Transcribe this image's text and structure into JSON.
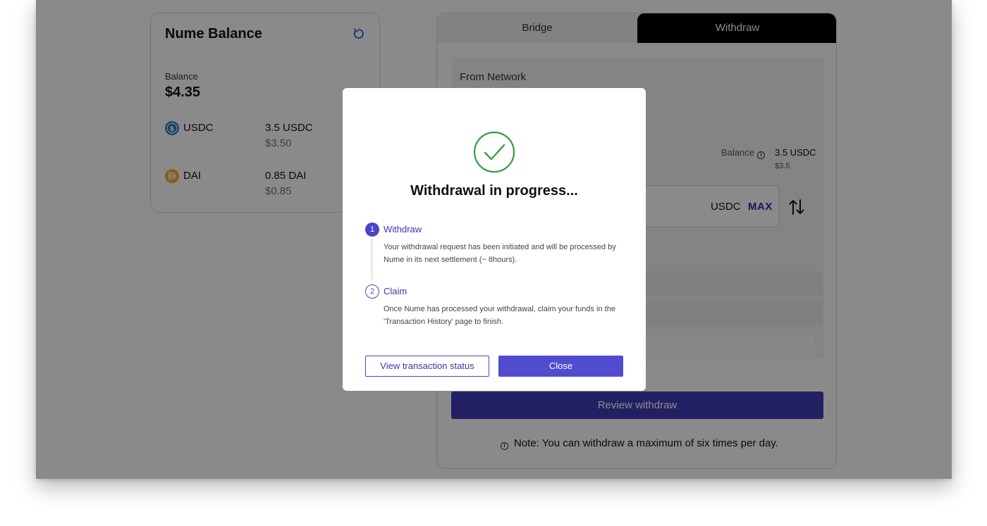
{
  "balance_card": {
    "title": "Nume Balance",
    "balance_label": "Balance",
    "balance_value": "$4.35",
    "tokens": [
      {
        "name": "USDC",
        "amount": "3.5 USDC",
        "usd": "$3.50",
        "icon": "usdc-icon",
        "color": "#2775ca"
      },
      {
        "name": "DAI",
        "amount": "0.85 DAI",
        "usd": "$0.85",
        "icon": "dai-icon",
        "color": "#f5ac37"
      }
    ]
  },
  "panel": {
    "tabs": [
      "Bridge",
      "Withdraw"
    ],
    "active_tab": "Withdraw",
    "from_network_label": "From Network",
    "balance_label": "Balance",
    "balance_token": "3.5 USDC",
    "balance_usd": "$3.5",
    "amount_token": "USDC",
    "max_label": "MAX",
    "review_button": "Review withdraw",
    "note": "Note: You can withdraw a maximum of six times per day."
  },
  "modal": {
    "title": "Withdrawal in progress...",
    "steps": [
      {
        "number": "1",
        "title": "Withdraw",
        "description": "Your withdrawal request has been initiated and will be processed by Nume in its next settlement (~ 8hours).",
        "state": "active"
      },
      {
        "number": "2",
        "title": "Claim",
        "description": "Once Nume has processed your withdrawal, claim your funds in the 'Transaction History' page to finish.",
        "state": "pending"
      }
    ],
    "view_status_button": "View transaction status",
    "close_button": "Close"
  },
  "colors": {
    "accent": "#514ccf",
    "success": "#3a9a3e",
    "overlay": "rgba(0,0,0,0.46)"
  }
}
